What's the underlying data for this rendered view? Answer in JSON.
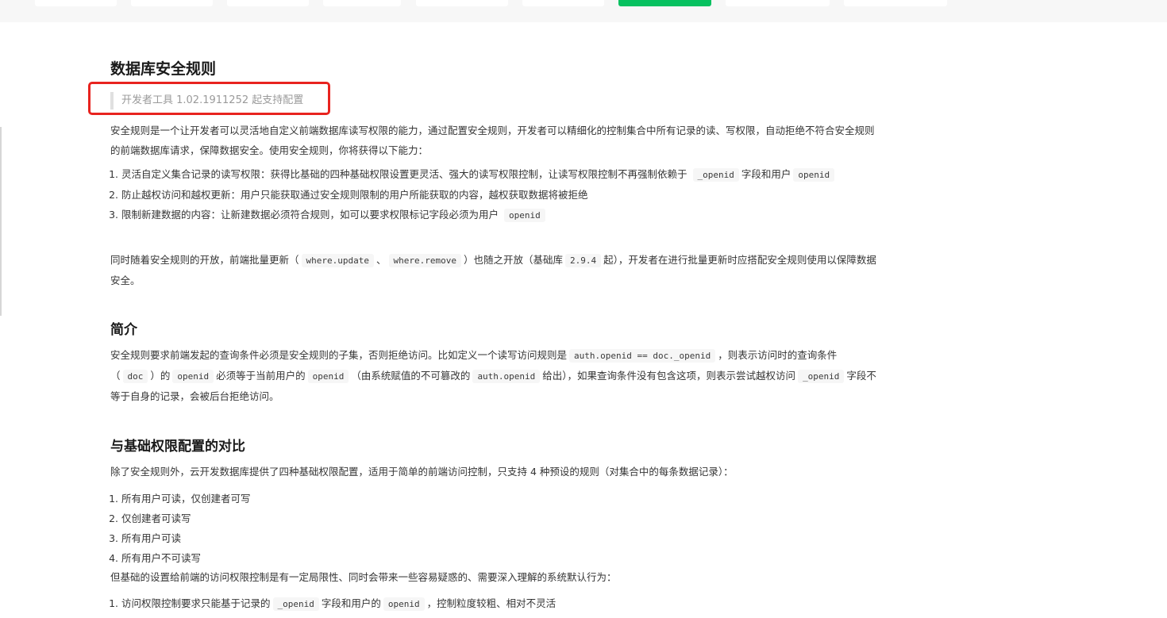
{
  "accent_color": "#07c160",
  "highlight_color": "#e8231f",
  "title": "数据库安全规则",
  "version_note": "开发者工具 1.02.1911252 起支持配置",
  "intro": {
    "text1": "安全规则是一个让开发者可以灵活地自定义前端数据库读写权限的能力，通过配置安全规则，开发者可以精细化的控制集合中所有记录的读、写权限，自动拒绝不符合安全规则的前端数据库请求，保障数据安全。使用安全规则，你将获得以下能力："
  },
  "abilities": {
    "item1_text": "灵活自定义集合记录的读写权限：获得比基础的四种基础权限设置更灵活、强大的读写权限控制，让读写权限控制不再强制依赖于",
    "item1_code1": "_openid",
    "item1_mid": "字段和用户",
    "item1_code2": "openid",
    "item2": "防止越权访问和越权更新：用户只能获取通过安全规则限制的用户所能获取的内容，越权获取数据将被拒绝",
    "item3_text": "限制新建数据的内容：让新建数据必须符合规则，如可以要求权限标记字段必须为用户",
    "item3_code": "openid"
  },
  "batch": {
    "t1": "同时随着安全规则的开放，前端批量更新（",
    "c1": "where.update",
    "t2": "、",
    "c2": "where.remove",
    "t3": "）也随之开放（基础库",
    "c3": "2.9.4",
    "t4": "起），开发者在进行批量更新时应搭配安全规则使用以保障数据安全。"
  },
  "section_intro": {
    "heading": "简介",
    "t1": "安全规则要求前端发起的查询条件必须是安全规则的子集，否则拒绝访问。比如定义一个读写访问规则是",
    "c1": "auth.openid == doc._openid",
    "t2": "，则表示访问时的查询条件（",
    "c2": "doc",
    "t3": "）的",
    "c3": "openid",
    "t4": "必须等于当前用户的",
    "c4": "openid",
    "t5": "（由系统赋值的不可篡改的",
    "c5": "auth.openid",
    "t6": "给出），如果查询条件没有包含这项，则表示尝试越权访问",
    "c6": "_openid",
    "t7": "字段不等于自身的记录，会被后台拒绝访问。"
  },
  "section_compare": {
    "heading": "与基础权限配置的对比",
    "p1": "除了安全规则外，云开发数据库提供了四种基础权限配置，适用于简单的前端访问控制，只支持 4 种预设的规则（对集合中的每条数据记录）：",
    "rules": [
      "所有用户可读，仅创建者可写",
      "仅创建者可读写",
      "所有用户可读",
      "所有用户不可读写"
    ],
    "p2": "但基础的设置给前端的访问权限控制是有一定局限性、同时会带来一些容易疑惑的、需要深入理解的系统默认行为：",
    "limit1_t1": "访问权限控制要求只能基于记录的",
    "limit1_c1": "_openid",
    "limit1_t2": "字段和用户的",
    "limit1_c2": "openid",
    "limit1_t3": "，控制粒度较粗、相对不灵活"
  }
}
